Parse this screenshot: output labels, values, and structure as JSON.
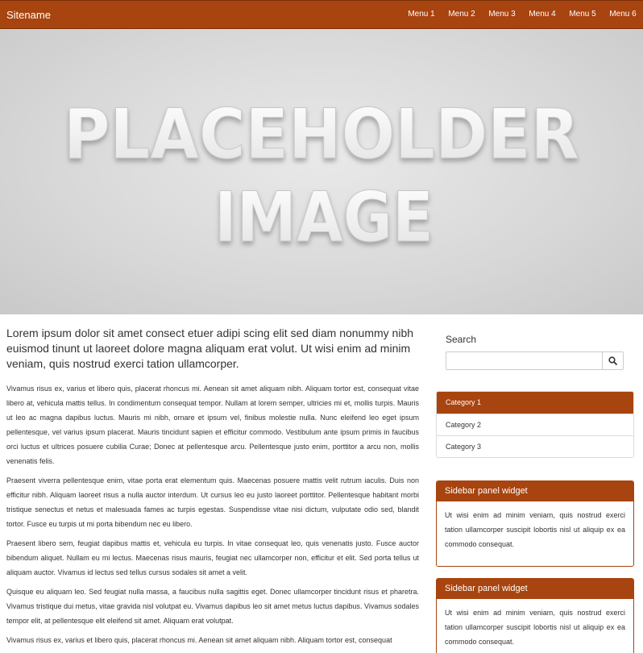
{
  "navbar": {
    "brand": "Sitename",
    "menu": [
      "Menu 1",
      "Menu 2",
      "Menu 3",
      "Menu 4",
      "Menu 5",
      "Menu 6"
    ],
    "color": "#a8440f"
  },
  "hero": {
    "line1": "PLACEHOLDER",
    "line2": "IMAGE"
  },
  "main": {
    "lead": "Lorem ipsum dolor sit amet consect etuer adipi scing elit sed diam nonummy nibh euismod tinunt ut laoreet dolore magna aliquam erat volut. Ut wisi enim ad minim veniam, quis nostrud exerci tation ullamcorper.",
    "paragraphs": [
      "Vivamus risus ex, varius et libero quis, placerat rhoncus mi. Aenean sit amet aliquam nibh. Aliquam tortor est, consequat vitae libero at, vehicula mattis tellus. In condimentum consequat tempor. Nullam at lorem semper, ultricies mi et, mollis turpis. Mauris ut leo ac magna dapibus luctus. Mauris mi nibh, ornare et ipsum vel, finibus molestie nulla. Nunc eleifend leo eget ipsum pellentesque, vel varius ipsum placerat. Mauris tincidunt sapien et efficitur commodo. Vestibulum ante ipsum primis in faucibus orci luctus et ultrices posuere cubilia Curae; Donec at pellentesque arcu. Pellentesque justo enim, porttitor a arcu non, mollis venenatis felis.",
      "Praesent viverra pellentesque enim, vitae porta erat elementum quis. Maecenas posuere mattis velit rutrum iaculis. Duis non efficitur nibh. Aliquam laoreet risus a nulla auctor interdum. Ut cursus leo eu justo laoreet porttitor. Pellentesque habitant morbi tristique senectus et netus et malesuada fames ac turpis egestas. Suspendisse vitae nisi dictum, vulputate odio sed, blandit tortor. Fusce eu turpis ut mi porta bibendum nec eu libero.",
      "Praesent libero sem, feugiat dapibus mattis et, vehicula eu turpis. In vitae consequat leo, quis venenatis justo. Fusce auctor bibendum aliquet. Nullam eu mi lectus. Maecenas risus mauris, feugiat nec ullamcorper non, efficitur et elit. Sed porta tellus ut aliquam auctor. Vivamus id lectus sed tellus cursus sodales sit amet a velit.",
      "Quisque eu aliquam leo. Sed feugiat nulla massa, a faucibus nulla sagittis eget. Donec ullamcorper tincidunt risus et pharetra. Vivamus tristique dui metus, vitae gravida nisl volutpat eu. Vivamus dapibus leo sit amet metus luctus dapibus. Vivamus sodales tempor elit, at pellentesque elit eleifend sit amet. Aliquam erat volutpat.",
      "Vivamus risus ex, varius et libero quis, placerat rhoncus mi. Aenean sit amet aliquam nibh. Aliquam tortor est, consequat"
    ]
  },
  "sidebar": {
    "search": {
      "label": "Search",
      "placeholder": "",
      "icon": "search-icon"
    },
    "categories": [
      "Category 1",
      "Category 2",
      "Category 3"
    ],
    "panels": [
      {
        "title": "Sidebar panel widget",
        "body": "Ut wisi enim ad minim veniam, quis nostrud exerci tation ullamcorper suscipit lobortis nisl ut aliquip ex ea commodo consequat."
      },
      {
        "title": "Sidebar panel widget",
        "body": "Ut wisi enim ad minim veniam, quis nostrud exerci tation ullamcorper suscipit lobortis nisl ut aliquip ex ea commodo consequat."
      }
    ]
  }
}
